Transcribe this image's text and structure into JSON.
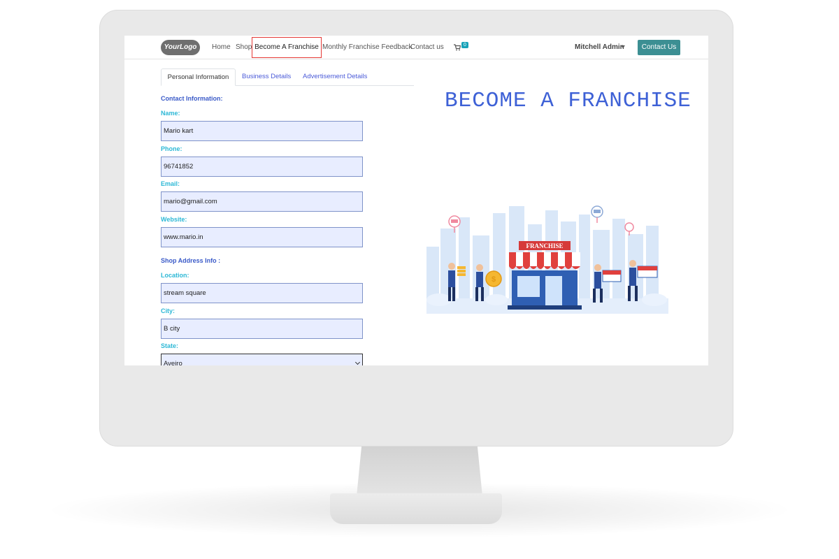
{
  "navbar": {
    "logo_text": "YourLogo",
    "items": [
      "Home",
      "Shop",
      "Become A Franchise",
      "Monthly Franchise Feedback",
      "Contact us"
    ],
    "active_item": "Become A Franchise",
    "cart_icon": "cart-icon",
    "cart_count": "0",
    "user_name": "Mitchell Admin",
    "contact_button": "Contact Us"
  },
  "tabs": [
    "Personal Information",
    "Business Details",
    "Advertisement Details"
  ],
  "active_tab": "Personal Information",
  "form": {
    "contact_section": "Contact Information:",
    "name_label": "Name:",
    "name_value": "Mario kart",
    "phone_label": "Phone:",
    "phone_value": "96741852",
    "email_label": "Email:",
    "email_value": "mario@gmail.com",
    "website_label": "Website:",
    "website_value": "www.mario.in",
    "address_section": "Shop Address Info :",
    "location_label": "Location:",
    "location_value": "stream square",
    "city_label": "City:",
    "city_value": "B city",
    "state_label": "State:",
    "state_value": "Aveiro"
  },
  "banner": {
    "title": "BECOME A FRANCHISE",
    "store_sign": "FRANCHISE"
  },
  "colors": {
    "accent_blue": "#3e61d6",
    "label_cyan": "#2db8d6",
    "button_teal": "#3c8f93",
    "active_outline": "#e53935",
    "field_bg": "#e8edff"
  }
}
